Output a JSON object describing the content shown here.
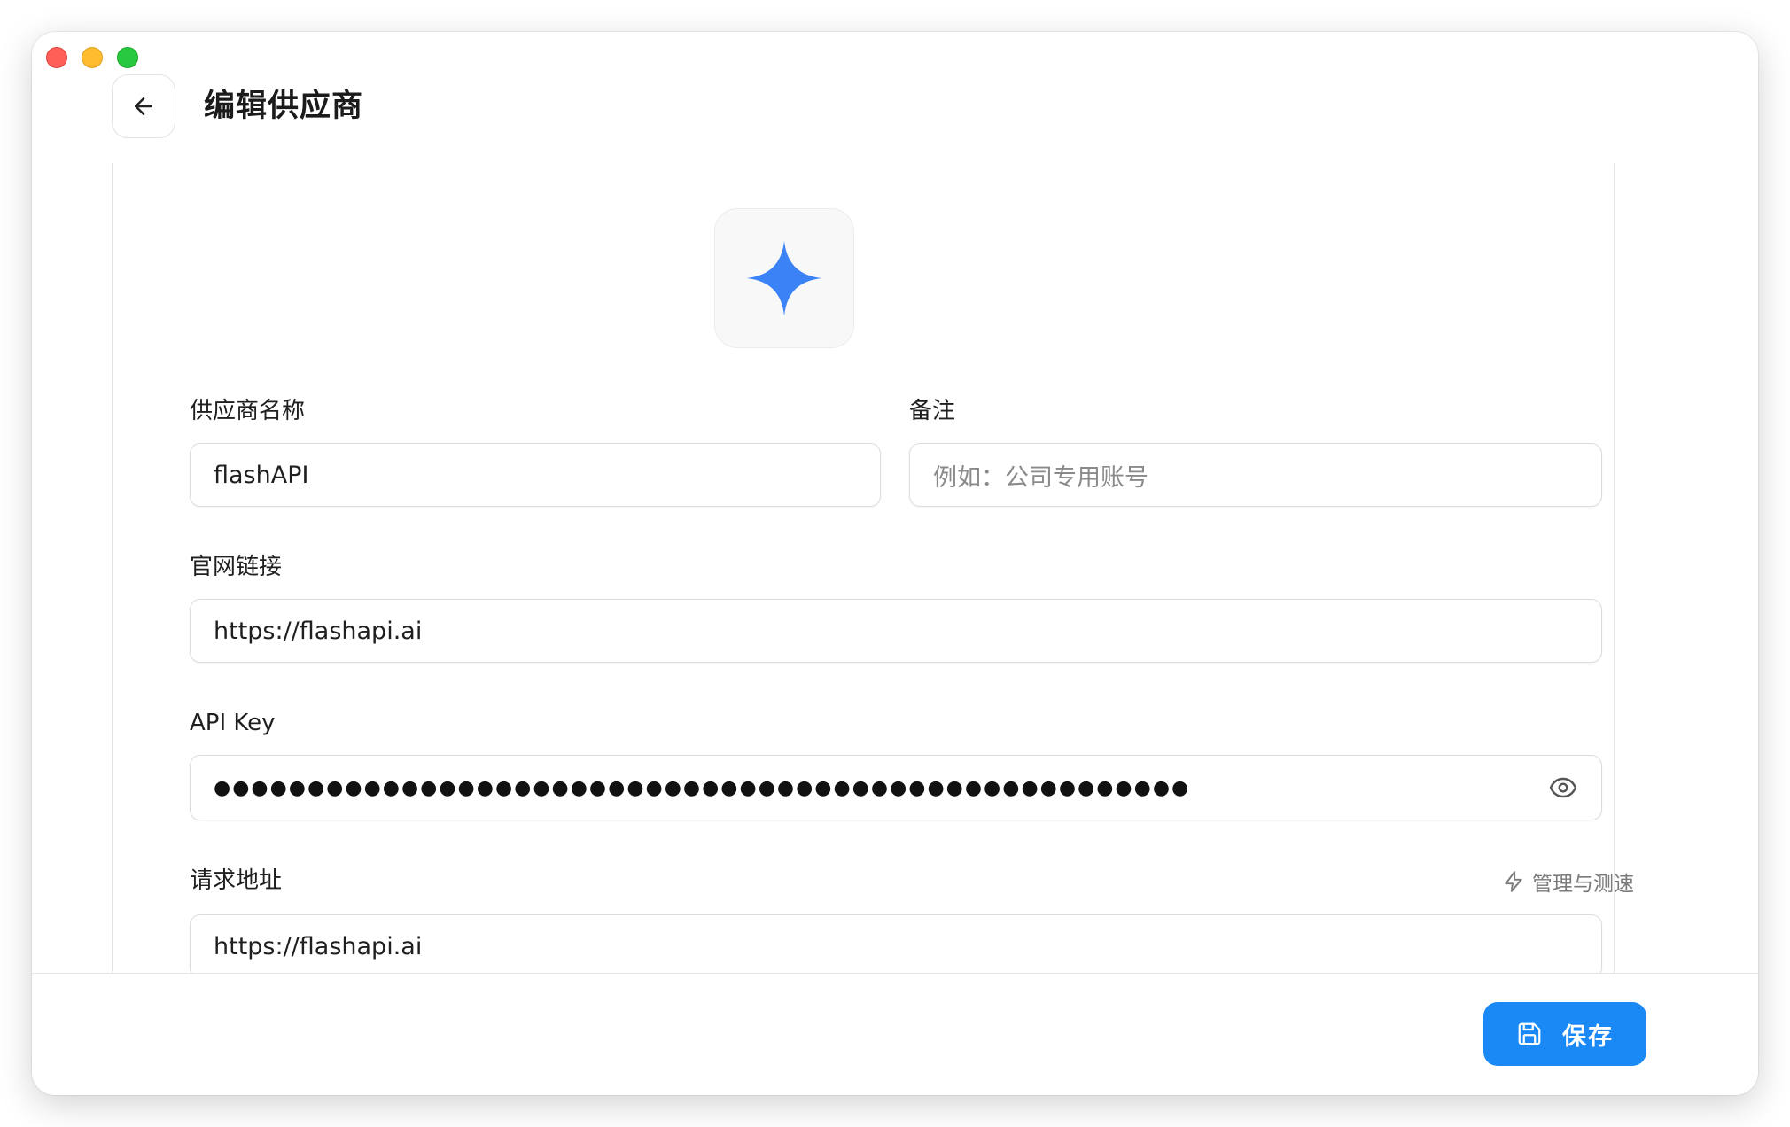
{
  "header": {
    "title": "编辑供应商"
  },
  "provider": {
    "icon": "sparkle-icon",
    "accent_color": "#3b82f6"
  },
  "form": {
    "name": {
      "label": "供应商名称",
      "value": "flashAPI"
    },
    "note": {
      "label": "备注",
      "placeholder": "例如：公司专用账号"
    },
    "website": {
      "label": "官网链接",
      "value": "https://flashapi.ai"
    },
    "api_key": {
      "label": "API Key",
      "masked_value": "●●●●●●●●●●●●●●●●●●●●●●●●●●●●●●●●●●●●●●●●●●●●●●●●●●●●"
    },
    "endpoint": {
      "label": "请求地址",
      "value": "https://flashapi.ai",
      "manage_label": "管理与测速"
    }
  },
  "footer": {
    "save_label": "保存",
    "save_color": "#1a88f5"
  }
}
